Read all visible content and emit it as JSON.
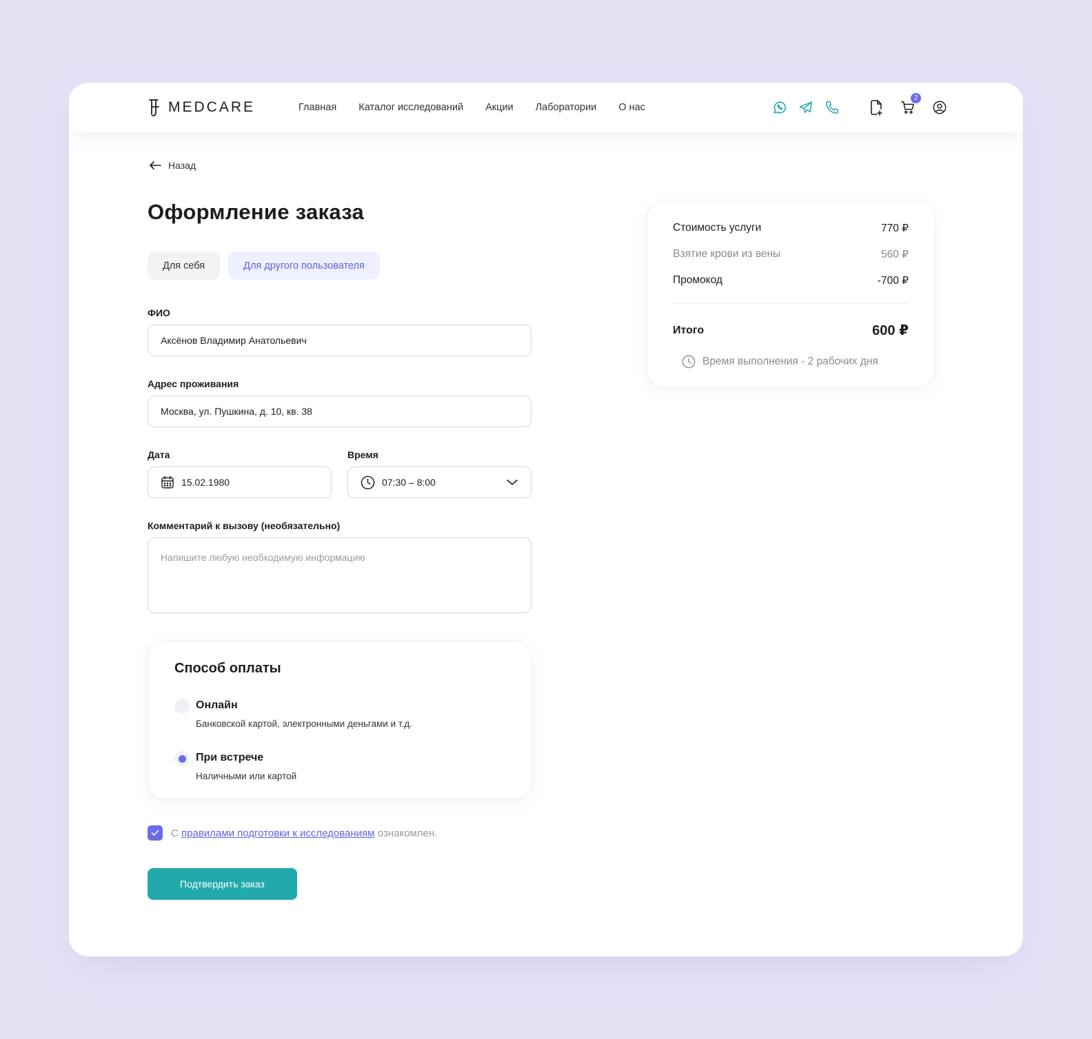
{
  "brand": {
    "name": "MEDCARE"
  },
  "nav": {
    "items": [
      "Главная",
      "Каталог исследований",
      "Акции",
      "Лаборатории",
      "О нас"
    ]
  },
  "header_icons": {
    "whatsapp": "whatsapp-icon",
    "telegram": "telegram-icon",
    "phone": "phone-icon",
    "document": "document-add-icon",
    "cart": "cart-icon",
    "cart_count": "2",
    "profile": "user-icon"
  },
  "colors": {
    "accent": "#6b6ce8",
    "teal": "#22a9ab",
    "background": "#e6e2f6"
  },
  "back": {
    "label": "Назад"
  },
  "page": {
    "title": "Оформление заказа"
  },
  "tabs": [
    {
      "label": "Для себя",
      "active": false
    },
    {
      "label": "Для другого пользователя",
      "active": true
    }
  ],
  "form": {
    "fio": {
      "label": "ФИО",
      "value": "Аксёнов Владимир Анатольевич"
    },
    "address": {
      "label": "Адрес проживания",
      "value": "Москва, ул. Пушкина, д. 10, кв. 38"
    },
    "date": {
      "label": "Дата",
      "value": "15.02.1980"
    },
    "time": {
      "label": "Время",
      "value": "07:30 – 8:00"
    },
    "comment": {
      "label": "Комментарий к вызову (необязательно)",
      "placeholder": "Напишите любую необходимую информацию"
    }
  },
  "payment": {
    "title": "Способ оплаты",
    "options": [
      {
        "title": "Онлайн",
        "desc": "Банковской картой, электронными деньгами и т.д.",
        "selected": false
      },
      {
        "title": "При встрече",
        "desc": "Наличными или картой",
        "selected": true
      }
    ]
  },
  "agreement": {
    "prefix": "С",
    "link": "правилами подготовки к исследованиям",
    "suffix": "ознакомлен.",
    "checked": true
  },
  "confirm": {
    "label": "Подтвердить заказ"
  },
  "summary": {
    "rows": [
      {
        "label": "Стоимость услуги",
        "value": "770 ₽"
      },
      {
        "label": "Взятие крови из вены",
        "value": "560 ₽"
      },
      {
        "label": "Промокод",
        "value": "-700 ₽"
      }
    ],
    "total_label": "Итого",
    "total_value": "600 ₽",
    "duration": "Время выполнения - 2 рабочих дня"
  }
}
